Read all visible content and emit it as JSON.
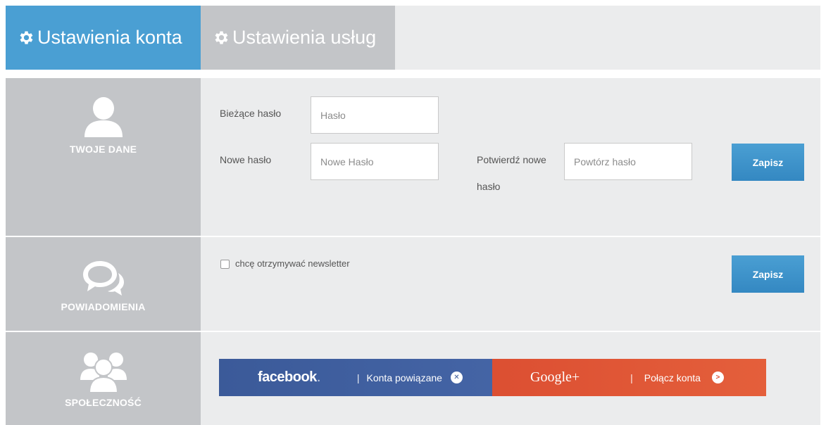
{
  "tabs": [
    {
      "label": "Ustawienia konta",
      "icon": "gear-icon",
      "active": true
    },
    {
      "label": "Ustawienia usług",
      "icon": "gear-icon",
      "active": false
    }
  ],
  "sections": {
    "profile": {
      "label": "TWOJE DANE",
      "icon": "user-icon",
      "current_password": {
        "label": "Bieżące hasło",
        "placeholder": "Hasło",
        "value": ""
      },
      "new_password": {
        "label": "Nowe hasło",
        "placeholder": "Nowe Hasło",
        "value": ""
      },
      "confirm_password": {
        "label_line1": "Potwierdź nowe",
        "label_line2": "hasło",
        "placeholder": "Powtórz hasło",
        "value": ""
      },
      "save_label": "Zapisz"
    },
    "notifications": {
      "label": "POWIADOMIENIA",
      "icon": "chat-bubbles-icon",
      "newsletter_label": "chcę otrzymywać newsletter",
      "newsletter_checked": false,
      "save_label": "Zapisz"
    },
    "social": {
      "label": "SPOŁECZNOŚĆ",
      "icon": "group-icon",
      "facebook": {
        "brand": "facebook",
        "separator": "|",
        "action": "Konta powiązane",
        "action_icon": "close-circle-icon"
      },
      "google": {
        "brand": "Google+",
        "separator": "|",
        "action": "Połącz konta",
        "action_icon": "arrow-circle-icon"
      }
    }
  },
  "colors": {
    "accent": "#4a9fd3",
    "inactive_tab": "#c3c5c8",
    "panel_bg": "#ebeced",
    "facebook": "#3b5a99",
    "google": "#dc4f32"
  }
}
